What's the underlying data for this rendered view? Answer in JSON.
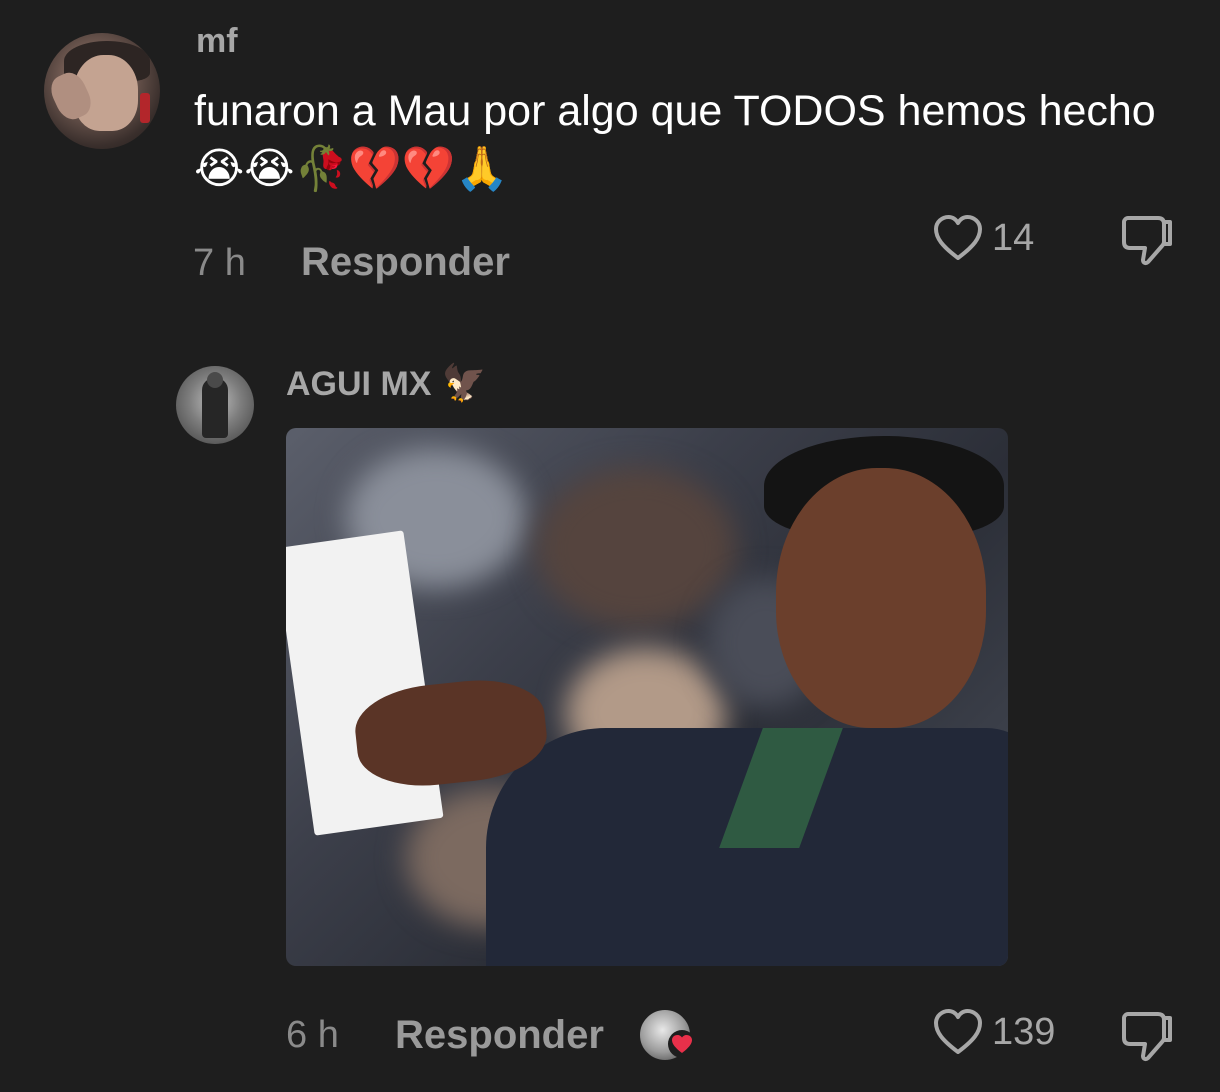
{
  "comments": [
    {
      "username": "mf",
      "text": "funaron a Mau por algo que TODOS hemos hecho",
      "emojis": "😭😭🥀💔💔🙏",
      "time": "7 h",
      "reply_label": "Responder",
      "likes": "14"
    },
    {
      "username": "AGUI MX",
      "username_emoji": "🦅",
      "time": "6 h",
      "reply_label": "Responder",
      "likes": "139",
      "creator_liked": true
    }
  ],
  "colors": {
    "background": "#1e1e1e",
    "text_primary": "#ffffff",
    "text_secondary": "#a7a7a7",
    "heart_red": "#e8304a"
  },
  "icons": [
    "heart-outline-icon",
    "thumbs-down-icon",
    "small-heart-icon"
  ]
}
